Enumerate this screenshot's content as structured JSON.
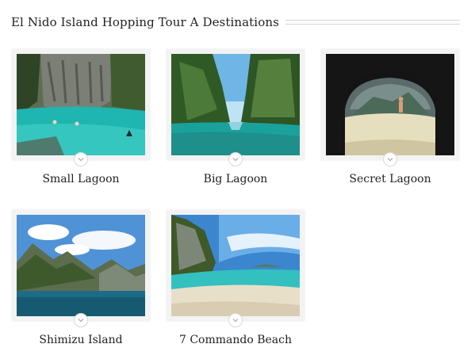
{
  "header": {
    "title": "El Nido Island Hopping Tour A Destinations"
  },
  "destinations": [
    {
      "name": "Small Lagoon",
      "image": "small-lagoon-photo",
      "icon": "chevron-down-icon"
    },
    {
      "name": "Big Lagoon",
      "image": "big-lagoon-photo",
      "icon": "chevron-down-icon"
    },
    {
      "name": "Secret Lagoon",
      "image": "secret-lagoon-photo",
      "icon": "chevron-down-icon"
    },
    {
      "name": "Shimizu Island",
      "image": "shimizu-island-photo",
      "icon": "chevron-down-icon"
    },
    {
      "name": "7 Commando Beach",
      "image": "commando-beach-photo",
      "icon": "chevron-down-icon"
    }
  ],
  "colors": {
    "lagoon_water": "#1fb5b0",
    "rock_green": "#3e5a2c",
    "sky_blue": "#5aa7de",
    "sand": "#e9e2c8"
  }
}
